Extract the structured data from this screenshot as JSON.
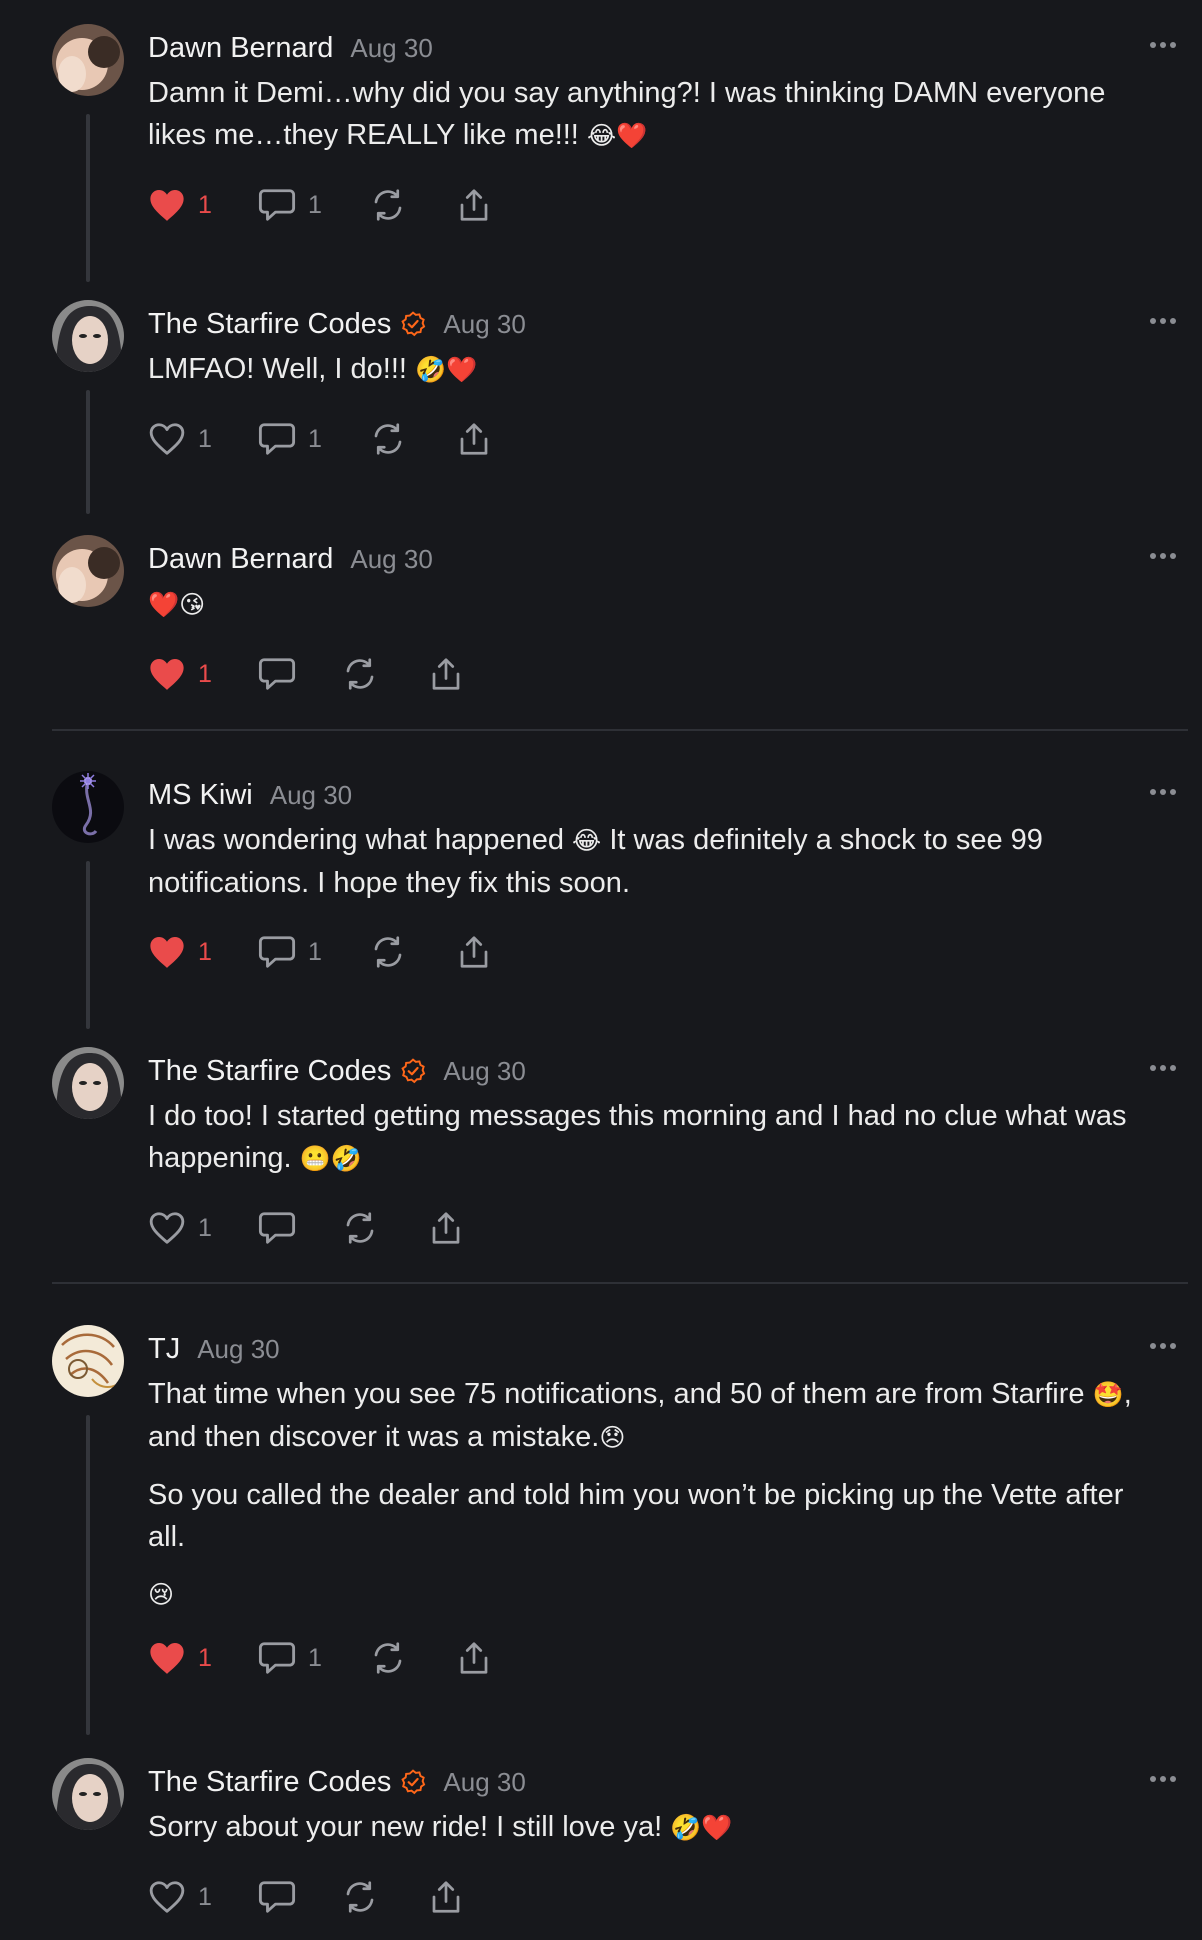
{
  "colors": {
    "background": "#17181c",
    "like_red": "#ea4b4b",
    "verified_orange": "#ff6719",
    "muted": "#8b8d93"
  },
  "icons": [
    "heart-icon",
    "comment-icon",
    "restack-icon",
    "share-icon",
    "more-icon",
    "verified-icon"
  ],
  "comments": [
    {
      "author": "Dawn Bernard",
      "date": "Aug 30",
      "verified": false,
      "avatar": "dawn",
      "text": "Damn it Demi…why did you say anything?! I was thinking DAMN everyone likes me…they REALLY like me!!!",
      "emoji": "😂❤️",
      "likes": "1",
      "liked": true,
      "replies": "1"
    },
    {
      "author": "The Starfire Codes",
      "date": "Aug 30",
      "verified": true,
      "avatar": "starfire",
      "text": "LMFAO! Well, I do!!!",
      "emoji": "🤣❤️",
      "likes": "1",
      "liked": false,
      "replies": "1"
    },
    {
      "author": "Dawn Bernard",
      "date": "Aug 30",
      "verified": false,
      "avatar": "dawn",
      "text": "",
      "emoji": "❤️😘",
      "likes": "1",
      "liked": true,
      "replies": ""
    },
    {
      "author": "MS Kiwi",
      "date": "Aug 30",
      "verified": false,
      "avatar": "kiwi",
      "text": "I was wondering what happened",
      "emoji": "😂",
      "text2": "It was definitely a shock to see 99 notifications. I hope they fix this soon.",
      "likes": "1",
      "liked": true,
      "replies": "1"
    },
    {
      "author": "The Starfire Codes",
      "date": "Aug 30",
      "verified": true,
      "avatar": "starfire",
      "text": "I do too! I started getting messages this morning and I had no clue what was happening.",
      "emoji": "😬🤣",
      "likes": "1",
      "liked": false,
      "replies": ""
    },
    {
      "author": "TJ",
      "date": "Aug 30",
      "verified": false,
      "avatar": "tj",
      "text": "That time when you see 75 notifications, and 50 of them are from Starfire",
      "emoji": "🤩",
      "text2": ", and then discover it was a mistake.",
      "emoji2": "😞",
      "para2": "So you called the dealer and told him you won’t be picking up the Vette after all.",
      "para3_emoji": "😢",
      "likes": "1",
      "liked": true,
      "replies": "1"
    },
    {
      "author": "The Starfire Codes",
      "date": "Aug 30",
      "verified": true,
      "avatar": "starfire",
      "text": "Sorry about your new ride! I still love ya!",
      "emoji": "🤣❤️",
      "likes": "1",
      "liked": false,
      "replies": ""
    }
  ]
}
